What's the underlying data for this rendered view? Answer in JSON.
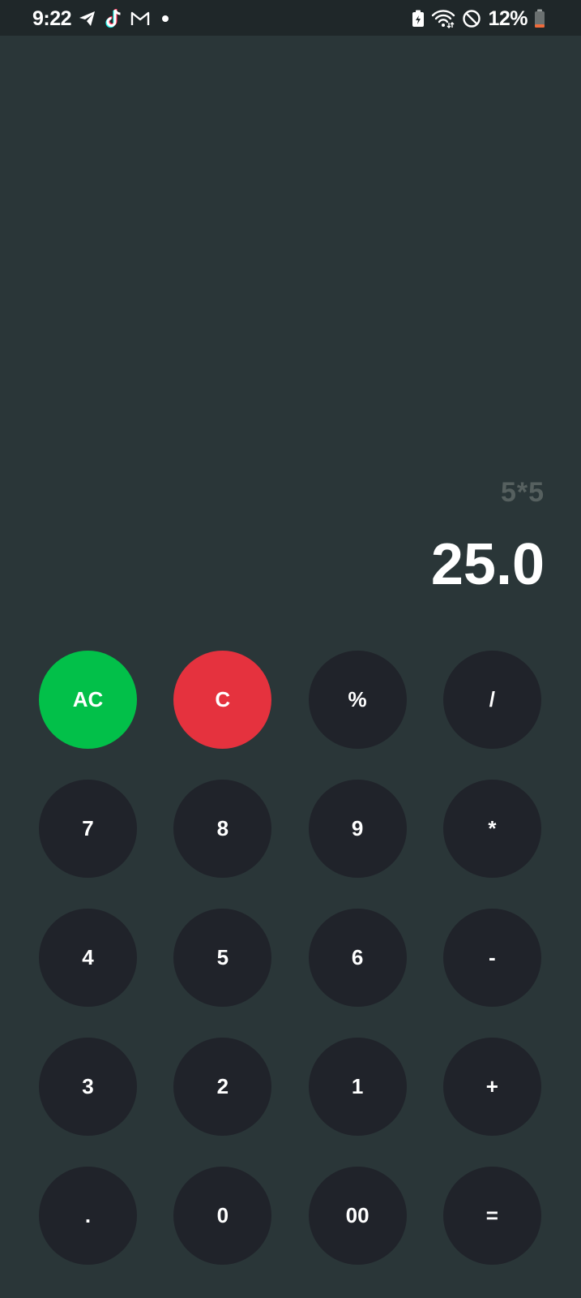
{
  "status_bar": {
    "time": "9:22",
    "battery_percent": "12%",
    "notification_icons": [
      "telegram-icon",
      "tiktok-icon",
      "gmail-icon",
      "dot-icon"
    ],
    "system_icons": [
      "battery-saver-icon",
      "wifi-icon",
      "do-not-disturb-icon",
      "battery-icon"
    ]
  },
  "display": {
    "expression": "5*5",
    "result": "25.0"
  },
  "keys": [
    {
      "label": "AC",
      "name": "all-clear-button"
    },
    {
      "label": "C",
      "name": "clear-button"
    },
    {
      "label": "%",
      "name": "percent-button"
    },
    {
      "label": "/",
      "name": "divide-button"
    },
    {
      "label": "7",
      "name": "digit-7-button"
    },
    {
      "label": "8",
      "name": "digit-8-button"
    },
    {
      "label": "9",
      "name": "digit-9-button"
    },
    {
      "label": "*",
      "name": "multiply-button"
    },
    {
      "label": "4",
      "name": "digit-4-button"
    },
    {
      "label": "5",
      "name": "digit-5-button"
    },
    {
      "label": "6",
      "name": "digit-6-button"
    },
    {
      "label": "-",
      "name": "subtract-button"
    },
    {
      "label": "3",
      "name": "digit-3-button"
    },
    {
      "label": "2",
      "name": "digit-2-button"
    },
    {
      "label": "1",
      "name": "digit-1-button"
    },
    {
      "label": "+",
      "name": "add-button"
    },
    {
      "label": ".",
      "name": "decimal-button"
    },
    {
      "label": "0",
      "name": "digit-0-button"
    },
    {
      "label": "00",
      "name": "double-zero-button"
    },
    {
      "label": "=",
      "name": "equals-button"
    }
  ],
  "colors": {
    "background": "#2a3638",
    "key": "#20232a",
    "ac_key": "#02c049",
    "c_key": "#e5323e",
    "expression_text": "#56605f",
    "result_text": "#ffffff"
  }
}
